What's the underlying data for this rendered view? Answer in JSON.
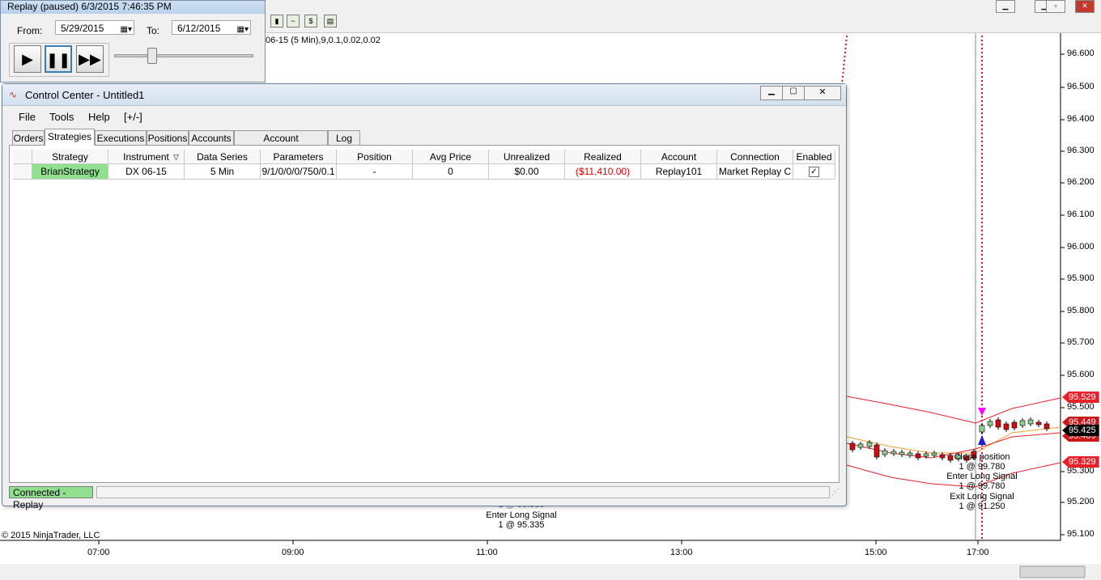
{
  "replay": {
    "title": "Replay (paused) 6/3/2015 7:46:35 PM",
    "from_label": "From:",
    "from_value": "5/29/2015",
    "to_label": "To:",
    "to_value": "6/12/2015",
    "speed_fraction": 0.27
  },
  "chart": {
    "series_label": "06-15 (5 Min),9,0.1,0.02,0.02",
    "copyright": "© 2015 NinjaTrader, LLC",
    "price_ticks": [
      "96.600",
      "96.500",
      "96.400",
      "96.300",
      "96.200",
      "96.100",
      "96.000",
      "95.900",
      "95.800",
      "95.700",
      "95.600",
      "95.500",
      "95.300",
      "95.200",
      "95.100"
    ],
    "time_ticks": [
      "07:00",
      "09:00",
      "11:00",
      "13:00",
      "15:00",
      "17:00"
    ],
    "price_tags": {
      "upper": "95.529",
      "mid": "95.449",
      "last": "95.425",
      "mid2": "95.409",
      "lower": "95.329"
    },
    "signals_left": {
      "line1": "1 @ 95.335",
      "line2": "Enter Long Signal",
      "line3": "1 @ 95.335"
    },
    "signals_right": {
      "close_pos": "Close position",
      "close_qty": "1 @ 99.780",
      "enter_long": "Enter Long Signal",
      "enter_qty": "1 @ 99.780",
      "exit_long": "Exit Long Signal",
      "exit_qty": "1 @ 91.250"
    },
    "colors": {
      "upper_band": "#e8202a",
      "mid_band": "#f0a030",
      "dotted": "#c8103c"
    }
  },
  "control_center": {
    "title": "Control Center - Untitled1",
    "menu": [
      "File",
      "Tools",
      "Help",
      "[+/-]"
    ],
    "tabs": [
      "Orders",
      "Strategies",
      "Executions",
      "Positions",
      "Accounts",
      "Account Performance",
      "Log"
    ],
    "active_tab": "Strategies",
    "columns": [
      "Strategy",
      "Instrument",
      "Data Series",
      "Parameters",
      "Position",
      "Avg Price",
      "Unrealized",
      "Realized",
      "Account",
      "Connection",
      "Enabled"
    ],
    "rows": [
      [
        "BrianStrategy",
        "DX 06-15",
        "5 Min",
        "9/1/0/0/0/750/0.1",
        "-",
        "0",
        "$0.00",
        "($11,410.00)",
        "Replay101",
        "Market Replay C",
        "✓"
      ]
    ],
    "status": "Connected - Replay",
    "colors": {
      "strategy_cell": "#90e090",
      "realized_negative": "#e00000",
      "status_bg": "#90e090"
    }
  }
}
